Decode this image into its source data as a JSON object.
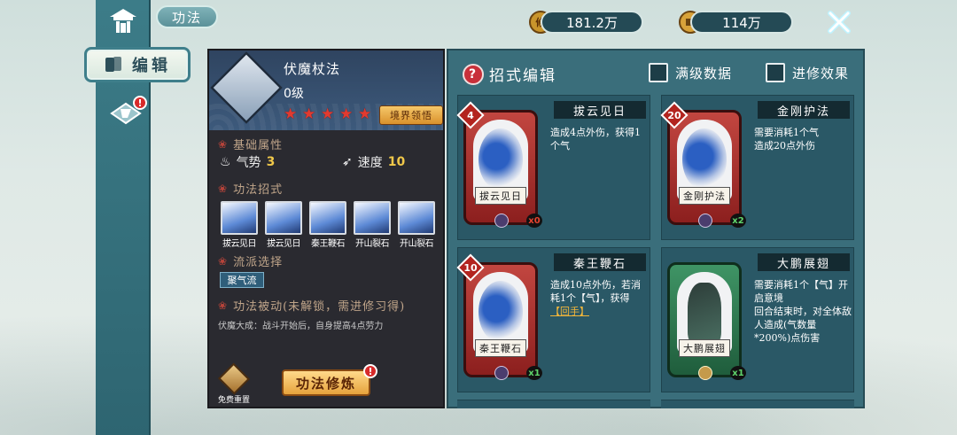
{
  "header": {
    "title": "功法"
  },
  "nav": {
    "edit_tab_label": "编辑",
    "other_tab_badge": "!"
  },
  "currency": [
    {
      "name": "cultivation-points",
      "icon_text": "修",
      "amount": "181.2万"
    },
    {
      "name": "coins",
      "icon_text": "",
      "amount": "114万"
    }
  ],
  "skill": {
    "name": "伏魔杖法",
    "level": "0级",
    "stars": 5,
    "realm_button": "境界领悟",
    "section_base": "基础属性",
    "attr_momentum_label": "气势",
    "attr_momentum_value": "3",
    "attr_speed_label": "速度",
    "attr_speed_value": "10",
    "section_moves": "功法招式",
    "moves": [
      "拔云见日",
      "拔云见日",
      "秦王鞭石",
      "开山裂石",
      "开山裂石"
    ],
    "section_school": "流派选择",
    "school_tag": "聚气流",
    "section_passive": "功法被动(未解锁，需进修习得)",
    "passive_text": "伏魔大成：战斗开始后，自身提高4点劳力",
    "reset_label": "免费重置",
    "cultivate_label": "功法修炼",
    "cultivate_badge": "!"
  },
  "moves_panel": {
    "title": "招式编辑",
    "help_icon": "?",
    "checkbox_max": "满级数据",
    "checkbox_effect": "进修效果",
    "cards": [
      {
        "name": "拔云见日",
        "cost": "4",
        "desc": "造成4点外伤，获得1个气",
        "count": "x0",
        "theme": "red"
      },
      {
        "name": "金刚护法",
        "cost": "20",
        "desc": "需要消耗1个气\n造成20点外伤",
        "count": "x2",
        "theme": "red"
      },
      {
        "name": "秦王鞭石",
        "cost": "10",
        "desc": "造成10点外伤，若消耗1个【气】，获得",
        "desc_hl": "【回手】",
        "count": "x1",
        "theme": "red"
      },
      {
        "name": "大鹏展翅",
        "cost": "",
        "desc": "需要消耗1个【气】开启意境\n回合结束时，对全体敌人造成(气数量*200%)点伤害",
        "count": "x1",
        "theme": "green"
      }
    ]
  }
}
